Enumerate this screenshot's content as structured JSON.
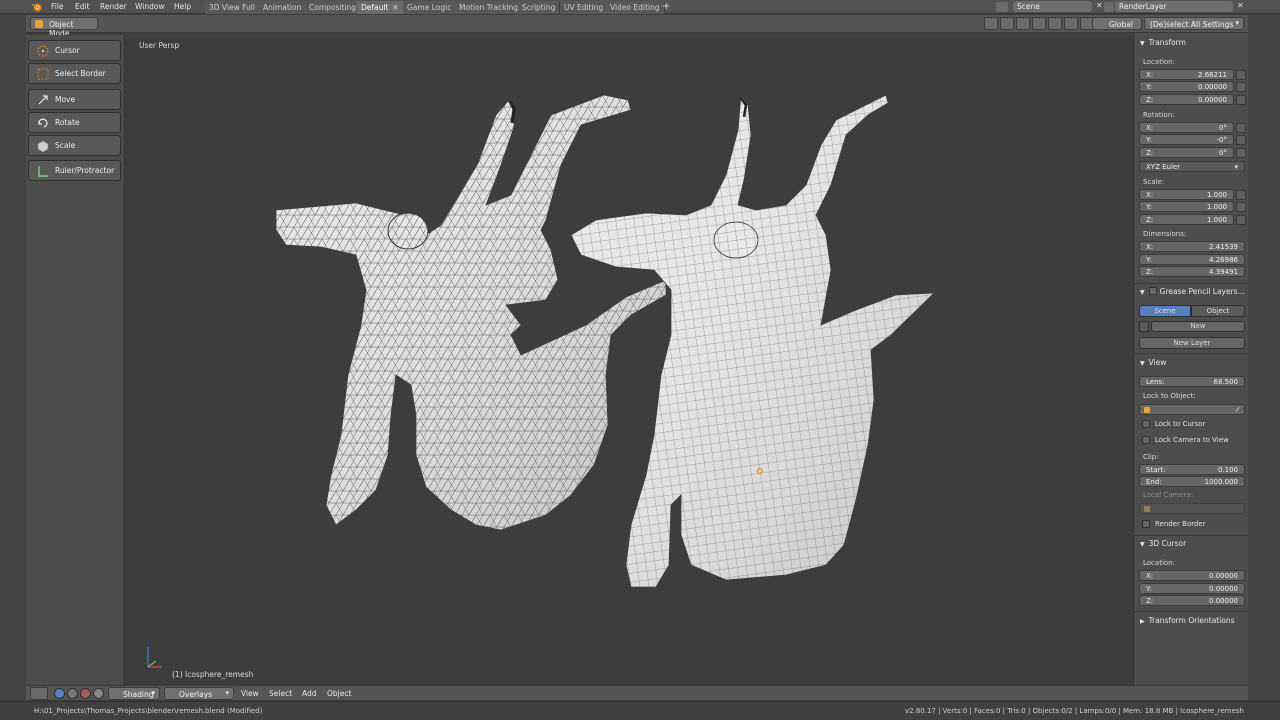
{
  "menubar": {
    "items": [
      "File",
      "Edit",
      "Render",
      "Window",
      "Help"
    ],
    "tabs": [
      {
        "label": "3D View Full",
        "active": false
      },
      {
        "label": "Animation",
        "active": false
      },
      {
        "label": "Compositing",
        "active": false
      },
      {
        "label": "Default",
        "active": true
      },
      {
        "label": "Game Logic",
        "active": false
      },
      {
        "label": "Motion Tracking",
        "active": false
      },
      {
        "label": "Scripting",
        "active": false
      },
      {
        "label": "UV Editing",
        "active": false
      },
      {
        "label": "Video Editing",
        "active": false
      }
    ],
    "scene": "Scene",
    "render_layer": "RenderLayer"
  },
  "header": {
    "mode": "Object Mode",
    "orientation": "Global",
    "settings": "(De)select All Settings"
  },
  "toolshelf": {
    "tools": [
      "Cursor",
      "Select Border",
      "Move",
      "Rotate",
      "Scale",
      "Ruler/Protractor"
    ]
  },
  "viewport": {
    "view_label": "User Persp",
    "object_label": "(1) Icosphere_remesh"
  },
  "properties": {
    "transform_header": "Transform",
    "location_label": "Location:",
    "location": {
      "x": "2.66211",
      "y": "0.00000",
      "z": "0.00000"
    },
    "rotation_label": "Rotation:",
    "rotation": {
      "x": "0°",
      "y": "-0°",
      "z": "0°"
    },
    "rotation_mode": "XYZ Euler",
    "scale_label": "Scale:",
    "scale": {
      "x": "1.000",
      "y": "1.000",
      "z": "1.000"
    },
    "dimensions_label": "Dimensions:",
    "dimensions": {
      "x": "2.41539",
      "y": "4.26986",
      "z": "4.39491"
    },
    "gp_header": "Grease Pencil Layers...",
    "gp_scene": "Scene",
    "gp_object": "Object",
    "gp_new": "New",
    "gp_new_layer": "New Layer",
    "view_header": "View",
    "lens_label": "Lens:",
    "lens_value": "68.500",
    "lock_to_object": "Lock to Object:",
    "lock_to_cursor": "Lock to Cursor",
    "lock_camera": "Lock Camera to View",
    "clip_label": "Clip:",
    "clip_start_label": "Start:",
    "clip_start": "0.100",
    "clip_end_label": "End:",
    "clip_end": "1000.000",
    "local_camera": "Local Camera:",
    "render_border": "Render Border",
    "cursor_header": "3D Cursor",
    "cursor_location_label": "Location:",
    "cursor_location": {
      "x": "0.00000",
      "y": "0.00000",
      "z": "0.00000"
    },
    "orientations_header": "Transform Orientations",
    "axis_x": "X:",
    "axis_y": "Y:",
    "axis_z": "Z:"
  },
  "bottombar": {
    "shading": "Shading",
    "overlays": "Overlays",
    "menus": [
      "View",
      "Select",
      "Add",
      "Object"
    ]
  },
  "statusbar": {
    "filepath": "H:\\01_Projects\\Thomas_Projects\\blender\\remesh.blend",
    "modified": "(Modified)",
    "stats": "v2.80.17 | Verts:0 | Faces:0 | Tris:0 | Objects:0/2 | Lamps:0/0 | Mem: 18.8 MB | Icosphere_remesh"
  },
  "colors": {
    "viewport_bg": "#3d3d3d",
    "mesh_fill": "#e8e8e8",
    "accent_blue": "#5680c2"
  }
}
